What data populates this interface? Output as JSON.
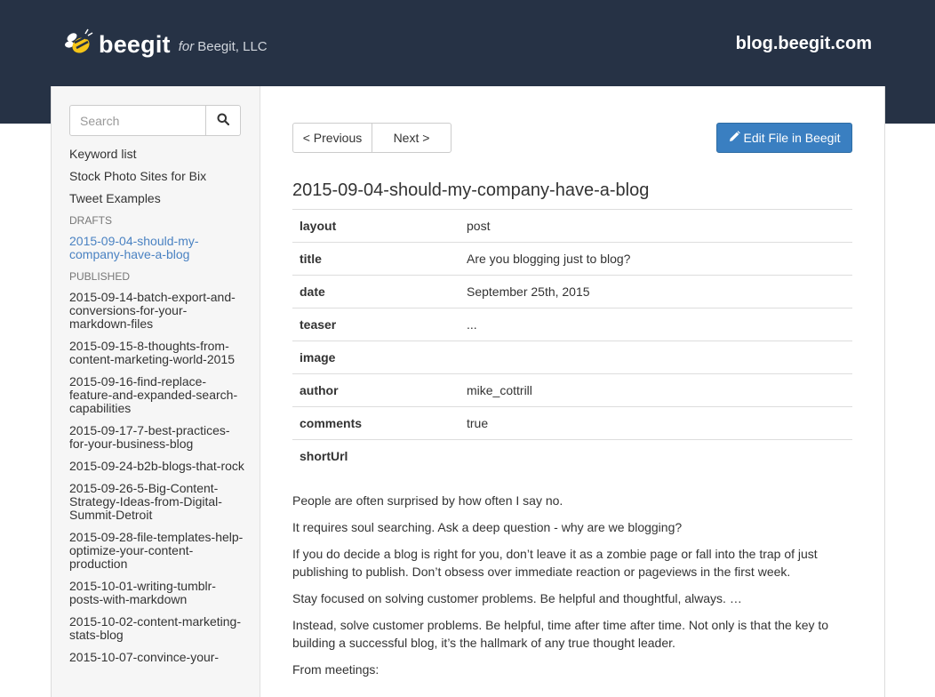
{
  "header": {
    "brand": "beegit",
    "for_label": "for",
    "org": "Beegit, LLC",
    "site": "blog.beegit.com"
  },
  "search": {
    "placeholder": "Search"
  },
  "sidebar": {
    "top_items": [
      "Keyword list",
      "Stock Photo Sites for Bix",
      "Tweet Examples"
    ],
    "drafts_heading": "DRAFTS",
    "drafts": [
      "2015-09-04-should-my-company-have-a-blog"
    ],
    "published_heading": "PUBLISHED",
    "published": [
      "2015-09-14-batch-export-and-conversions-for-your-markdown-files",
      "2015-09-15-8-thoughts-from-content-marketing-world-2015",
      "2015-09-16-find-replace-feature-and-expanded-search-capabilities",
      "2015-09-17-7-best-practices-for-your-business-blog",
      "2015-09-24-b2b-blogs-that-rock",
      "2015-09-26-5-Big-Content-Strategy-Ideas-from-Digital-Summit-Detroit",
      "2015-09-28-file-templates-help-optimize-your-content-production",
      "2015-10-01-writing-tumblr-posts-with-markdown",
      "2015-10-02-content-marketing-stats-blog",
      "2015-10-07-convince-your-"
    ]
  },
  "toolbar": {
    "prev_label": "< Previous",
    "next_label": "Next >",
    "edit_label": "Edit File in Beegit"
  },
  "file": {
    "title": "2015-09-04-should-my-company-have-a-blog",
    "meta": [
      {
        "key": "layout",
        "value": "post"
      },
      {
        "key": "title",
        "value": "Are you blogging just to blog?"
      },
      {
        "key": "date",
        "value": "September 25th, 2015"
      },
      {
        "key": "teaser",
        "value": "..."
      },
      {
        "key": "image",
        "value": ""
      },
      {
        "key": "author",
        "value": "mike_cottrill"
      },
      {
        "key": "comments",
        "value": "true"
      },
      {
        "key": "shortUrl",
        "value": ""
      }
    ],
    "paragraphs": [
      "People are often surprised by how often I say no.",
      "It requires soul searching. Ask a deep question - why are we blogging?",
      "If you do decide a blog is right for you, don’t leave it as a zombie page or fall into the trap of just publishing to publish. Don’t obsess over immediate reaction or pageviews in the first week.",
      "Stay focused on solving customer problems. Be helpful and thoughtful, always. …",
      "Instead, solve customer problems. Be helpful, time after time after time. Not only is that the key to building a successful blog, it’s the hallmark of any true thought leader.",
      "From meetings:"
    ]
  }
}
